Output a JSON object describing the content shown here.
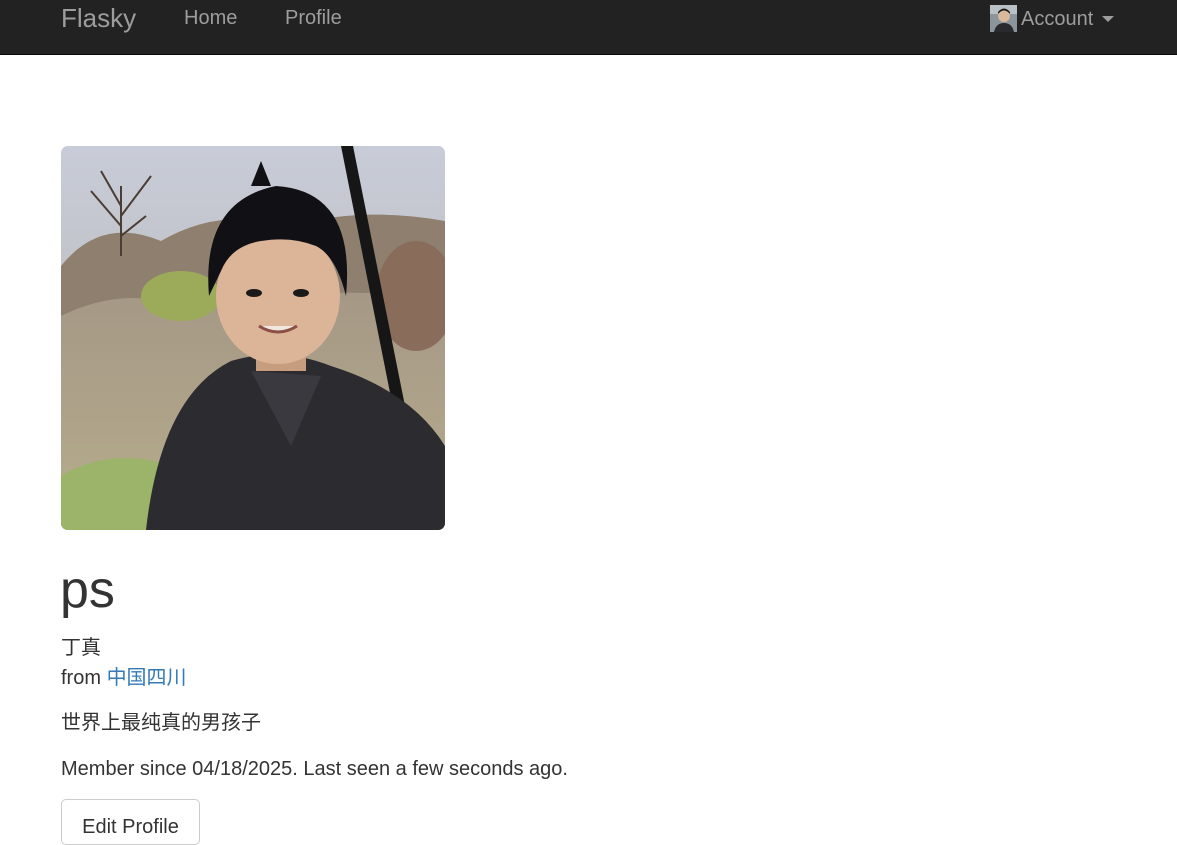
{
  "navbar": {
    "brand": "Flasky",
    "links": [
      {
        "label": "Home"
      },
      {
        "label": "Profile"
      }
    ],
    "account_label": "Account",
    "background": "#222222",
    "link_color": "#9d9d9d"
  },
  "profile": {
    "username": "ps",
    "real_name": "丁真",
    "location_prefix": "from",
    "location": "中国四川",
    "about_me": "世界上最纯真的男孩子",
    "member_text": "Member since 04/18/2025. Last seen a few seconds ago.",
    "edit_button_label": "Edit Profile",
    "link_color": "#337ab7"
  }
}
